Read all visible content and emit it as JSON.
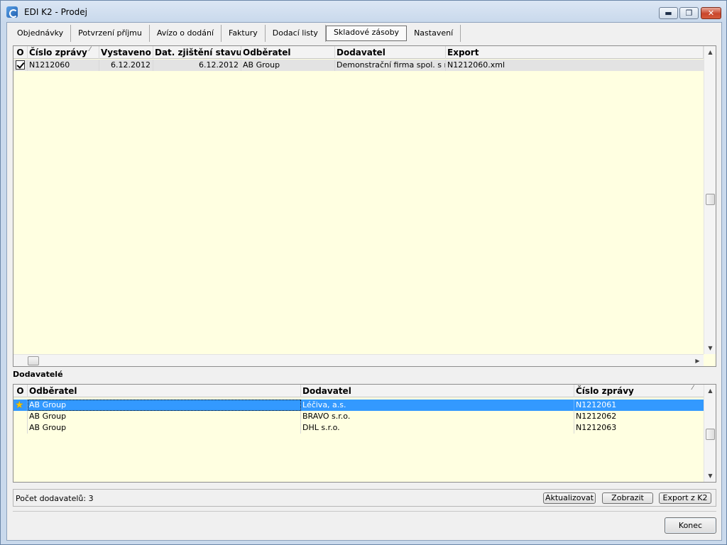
{
  "window": {
    "title": "EDI K2 - Prodej",
    "min_icon": "minimize-icon",
    "max_icon": "restore-icon",
    "close_icon": "close-icon"
  },
  "tabs": [
    {
      "label": "Objednávky",
      "active": false
    },
    {
      "label": "Potvrzení příjmu",
      "active": false
    },
    {
      "label": "Avízo o dodání",
      "active": false
    },
    {
      "label": "Faktury",
      "active": false
    },
    {
      "label": "Dodací listy",
      "active": false
    },
    {
      "label": "Skladové zásoby",
      "active": true
    },
    {
      "label": "Nastavení",
      "active": false
    }
  ],
  "top_grid": {
    "columns": [
      "O",
      "Číslo zprávy",
      "Vystaveno",
      "Dat. zjištění stavu",
      "Odběratel",
      "Dodavatel",
      "Export"
    ],
    "sort_column": "Číslo zprávy",
    "rows": [
      {
        "o": "checked",
        "cislo": "N1212060",
        "vystaveno": "6.12.2012",
        "dat_zjisteni": "6.12.2012",
        "odberatel": "AB Group",
        "dodavatel": "Demonstrační firma spol. s r.o.",
        "export": "N1212060.xml"
      }
    ]
  },
  "section_label": "Dodavatelé",
  "bottom_grid": {
    "columns": [
      "O",
      "Odběratel",
      "Dodavatel",
      "Číslo zprávy"
    ],
    "sort_column": "Číslo zprávy",
    "rows": [
      {
        "o": "star",
        "odberatel": "AB Group",
        "dodavatel": "Léčiva, a.s.",
        "cislo": "N1212061",
        "selected": true
      },
      {
        "o": "",
        "odberatel": "AB Group",
        "dodavatel": "BRAVO s.r.o.",
        "cislo": "N1212062",
        "selected": false
      },
      {
        "o": "",
        "odberatel": "AB Group",
        "dodavatel": "DHL s.r.o.",
        "cislo": "N1212063",
        "selected": false
      }
    ]
  },
  "status": {
    "label": "Počet dodavatelů:",
    "count": "3"
  },
  "buttons": {
    "aktualizovat": "Aktualizovat",
    "zobrazit": "Zobrazit",
    "export": "Export z K2",
    "konec": "Konec"
  },
  "colors": {
    "grid_background": "#ffffe1",
    "selection": "#3399ff"
  }
}
